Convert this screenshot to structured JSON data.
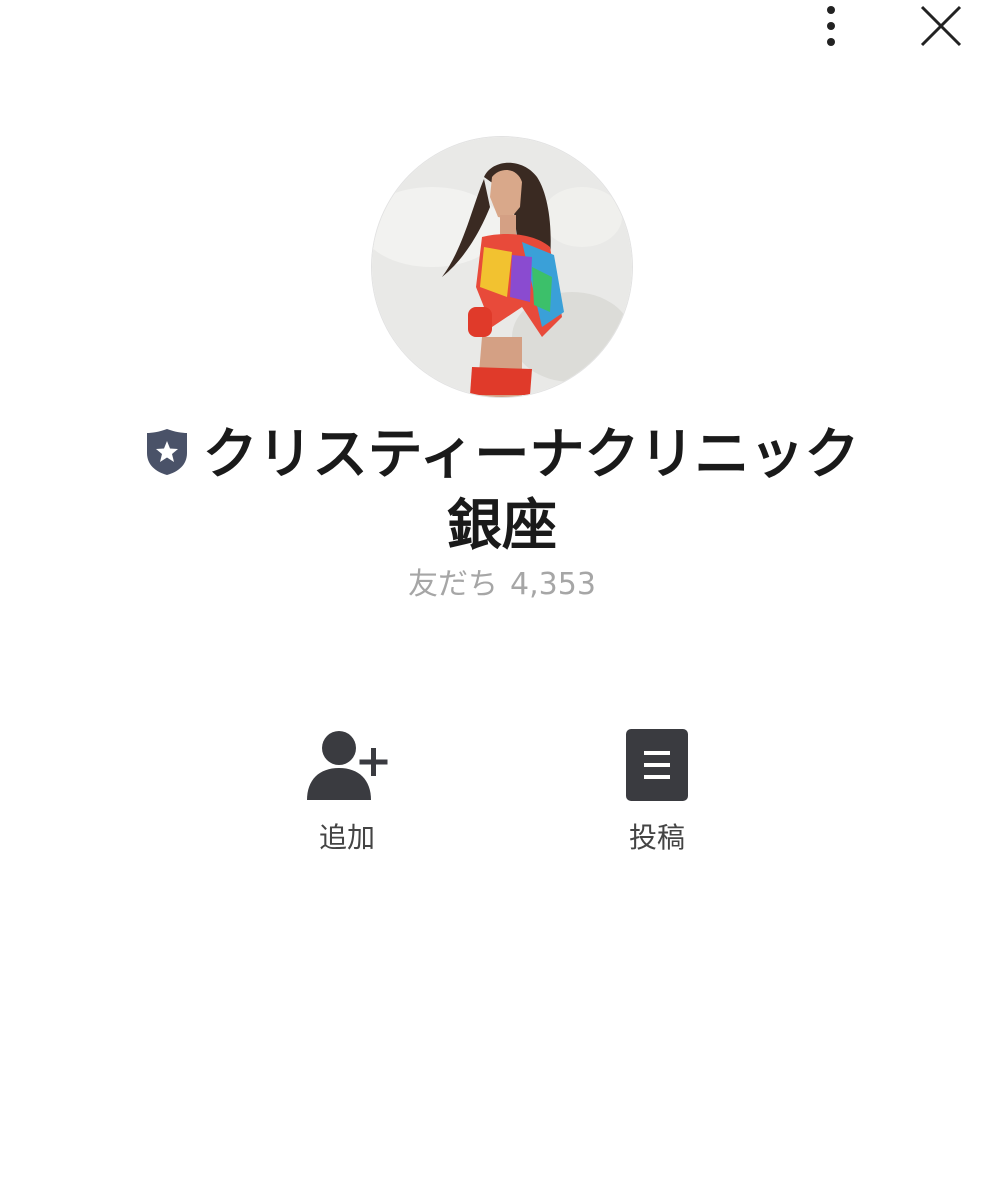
{
  "header": {
    "more_icon": "vertical-ellipsis-icon",
    "close_icon": "close-icon"
  },
  "profile": {
    "badge_icon": "verified-shield-star-icon",
    "badge_color": "#4a5268",
    "name_line1": "クリスティーナクリニック",
    "name_line2": "銀座",
    "friends_label": "友だち",
    "friends_count": "4,353"
  },
  "actions": [
    {
      "label": "追加",
      "icon": "add-friend-icon"
    },
    {
      "label": "投稿",
      "icon": "post-document-icon"
    }
  ],
  "colors": {
    "icon_dark": "#3a3b40",
    "text_primary": "#1a1a1a",
    "text_muted": "#a6a6a6"
  }
}
